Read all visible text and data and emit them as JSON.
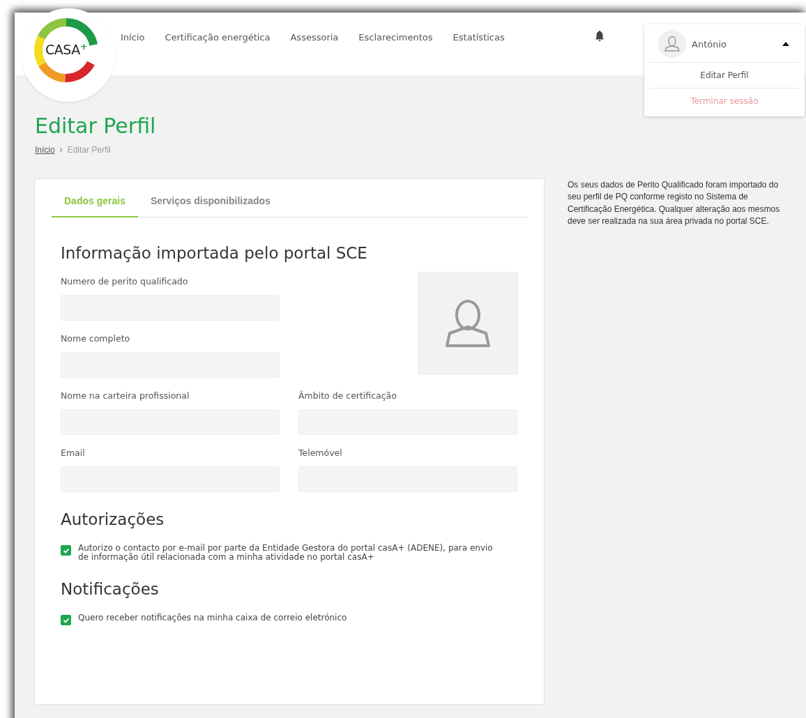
{
  "header": {
    "logo": "CASA$^{+}$",
    "nav": [
      {
        "label": "Início"
      },
      {
        "label": "Certificação energética"
      },
      {
        "label": "Assessoria"
      },
      {
        "label": "Esclarecimentos"
      },
      {
        "label": "Estatísticas"
      }
    ],
    "user_menu": {
      "name": "António",
      "expanded": true,
      "items": [
        {
          "label": "Editar Perfil",
          "kind": "normal"
        },
        {
          "label": "Terminar sessão",
          "kind": "danger"
        }
      ]
    }
  },
  "page": {
    "title": "Editar Perfil",
    "breadcrumb": [
      {
        "label": "Início",
        "kind": "link"
      },
      {
        "label": "Editar Perfil",
        "kind": "current"
      }
    ]
  },
  "tabs": [
    {
      "label": "Dados gerais",
      "selected": true
    },
    {
      "label": "Serviços disponibilizados",
      "selected": false
    }
  ],
  "section_title": "Informação importada pelo portal SCE",
  "fields": [
    {
      "label": "Numero de perito qualificado"
    },
    {
      "label": "Nome completo"
    },
    {
      "label": "Nome na carteira profissional"
    },
    {
      "label": "Âmbito de certificação"
    },
    {
      "label": "Email"
    },
    {
      "label": "Telemóvel"
    }
  ],
  "authorizations": {
    "title": "Autorizações",
    "options": [
      {
        "label": "Autorizo o contacto por e-mail por parte da Entidade Gestora do portal casA+ (ADENE), para envio de informação útil relacionada com a minha atividade no portal casA+",
        "checked": true
      }
    ]
  },
  "notifications": {
    "title": "Notificações",
    "options": [
      {
        "label": "Quero receber notificações na minha caixa de correio eletrónico",
        "checked": true
      }
    ]
  },
  "side_note": "Os seus dados de Perito Qualificado foram importado do seu perfil de PQ conforme registo no Sistema de Certificação Energética. Qualquer alteração aos mesmos deve ser realizada na sua área privada no portal SCE."
}
